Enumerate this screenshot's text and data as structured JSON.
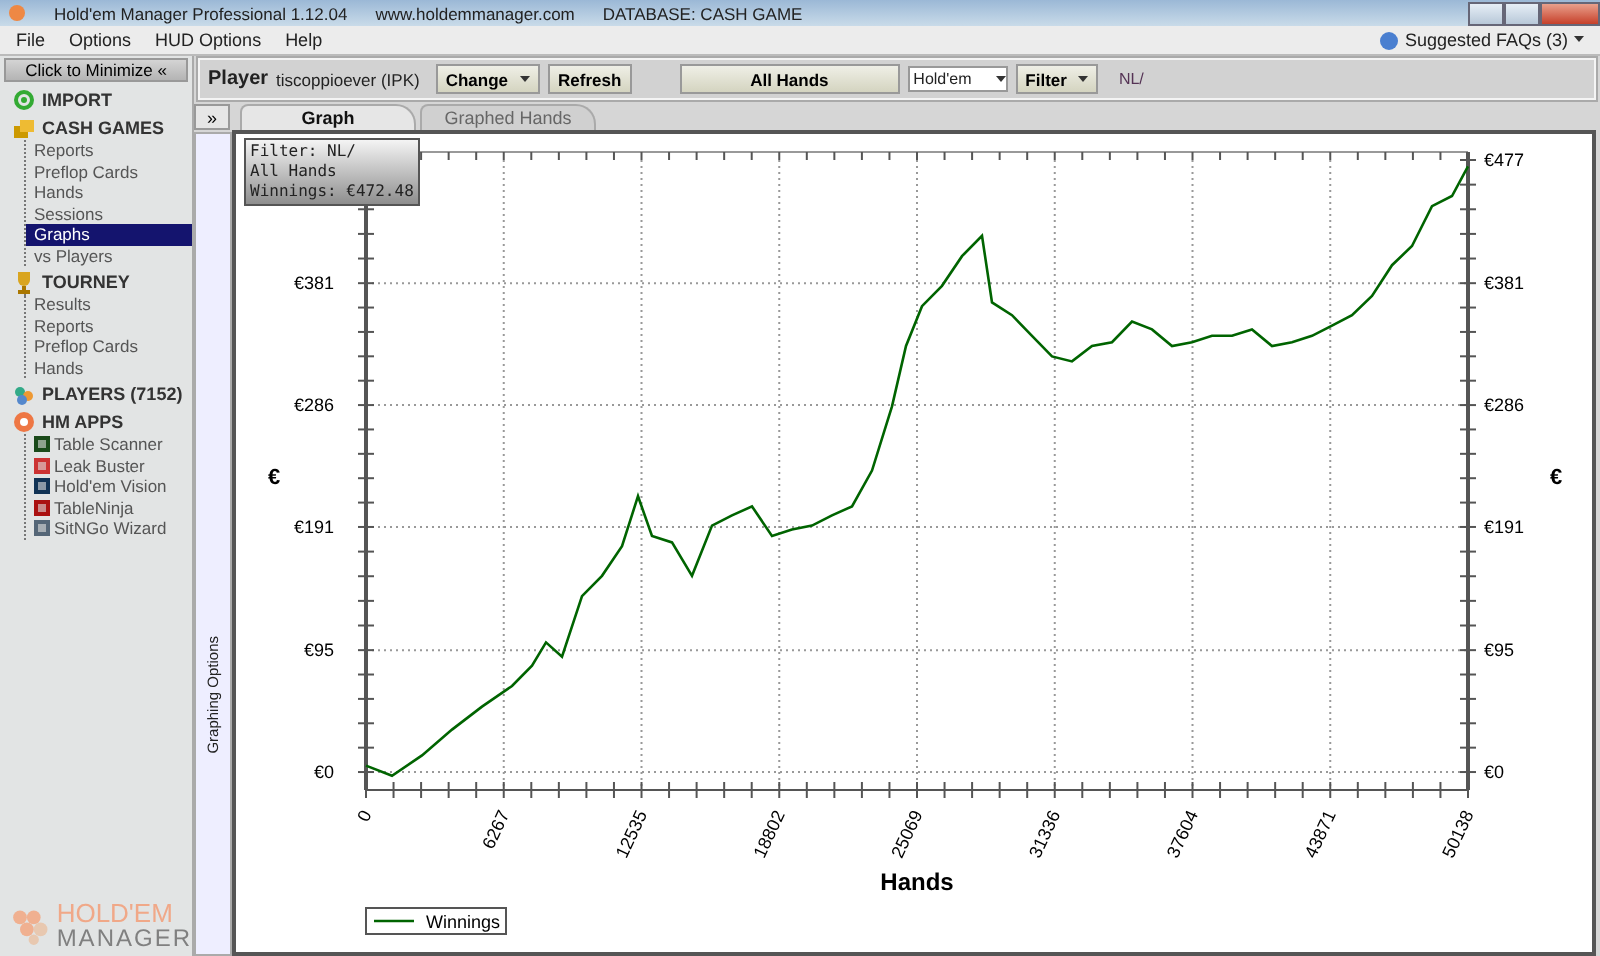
{
  "window": {
    "title": "Hold'em Manager Professional 1.12.04",
    "url": "www.holdemmanager.com",
    "database": "DATABASE: CASH GAME"
  },
  "menu": [
    "File",
    "Options",
    "HUD Options",
    "Help"
  ],
  "help": {
    "label": "Suggested FAQs (3)"
  },
  "sidebar": {
    "minimize": {
      "label": "Click to Minimize",
      "arrow": "«"
    },
    "sections": [
      {
        "label": "IMPORT"
      },
      {
        "label": "CASH GAMES",
        "children": [
          {
            "label": "Reports",
            "selected": false
          },
          {
            "label": "Preflop Cards",
            "selected": false
          },
          {
            "label": "Hands",
            "selected": false
          },
          {
            "label": "Sessions",
            "selected": false
          },
          {
            "label": "Graphs",
            "selected": true
          },
          {
            "label": "vs Players",
            "selected": false
          }
        ]
      },
      {
        "label": "TOURNEY",
        "children": [
          {
            "label": "Results",
            "selected": false
          },
          {
            "label": "Reports",
            "selected": false
          },
          {
            "label": "Preflop Cards",
            "selected": false
          },
          {
            "label": "Hands",
            "selected": false
          }
        ]
      },
      {
        "label": "PLAYERS (7152)"
      },
      {
        "label": "HM APPS",
        "children": [
          {
            "label": "Table Scanner",
            "selected": false
          },
          {
            "label": "Leak Buster",
            "selected": false
          },
          {
            "label": "Hold'em Vision",
            "selected": false
          },
          {
            "label": "TableNinja",
            "selected": false
          },
          {
            "label": "SitNGo Wizard",
            "selected": false
          }
        ]
      }
    ],
    "logo": [
      "HOLD'EM",
      "MANAGER"
    ]
  },
  "toolbar": {
    "player_label": "Player",
    "player": "tiscoppioever (IPK)",
    "change": "Change",
    "refresh": "Refresh",
    "all_hands": "All Hands",
    "game": "Hold'em",
    "filter": "Filter",
    "filter_value": "NL/"
  },
  "side_toggle": "»",
  "tabs": [
    {
      "label": "Graph",
      "selected": true
    },
    {
      "label": "Graphed Hands",
      "selected": false
    }
  ],
  "graphing_options": "Graphing Options",
  "graph": {
    "tooltip": [
      "Filter: NL/",
      "All Hands",
      "Winnings: €472.48"
    ],
    "right_axis_label": "€",
    "chart_data": {
      "type": "line",
      "grid": true,
      "xlabel": "Hands",
      "ylabel": "€",
      "xlim": [
        0,
        50138
      ],
      "ylim": [
        -14,
        477
      ],
      "xticks": [
        0,
        6267,
        12535,
        18802,
        25069,
        31336,
        37604,
        43871,
        50138
      ],
      "yticks": [
        {
          "value": 0,
          "label": "€0"
        },
        {
          "value": 95,
          "label": "€95"
        },
        {
          "value": 191,
          "label": "€191"
        },
        {
          "value": 286,
          "label": "€286"
        },
        {
          "value": 381,
          "label": "€381"
        },
        {
          "value": 477,
          "label": "€477"
        }
      ],
      "x": [
        0,
        1183,
        2548,
        3912,
        5277,
        6642,
        7552,
        8189,
        8917,
        9827,
        10737,
        11647,
        12375,
        13012,
        13921,
        14831,
        15741,
        16651,
        17561,
        18471,
        19381,
        20291,
        21201,
        22111,
        23021,
        23931,
        24568,
        25296,
        26206,
        27116,
        28026,
        28481,
        29391,
        30301,
        31211,
        32121,
        33031,
        33941,
        34851,
        35761,
        36671,
        37581,
        38491,
        39401,
        40311,
        41221,
        42131,
        43041,
        43951,
        44861,
        45771,
        46681,
        47591,
        48501,
        49411,
        50138
      ],
      "series": [
        {
          "name": "Winnings",
          "color": "#006400",
          "values": [
            5,
            -3,
            13,
            33,
            51,
            67,
            83,
            101,
            90,
            137,
            153,
            176,
            215,
            184,
            179,
            153,
            192,
            200,
            207,
            184,
            189,
            192,
            200,
            207,
            235,
            285,
            332,
            363,
            379,
            402,
            418,
            366,
            356,
            340,
            324,
            320,
            332,
            335,
            351,
            345,
            332,
            335,
            340,
            340,
            345,
            332,
            335,
            340,
            348,
            356,
            371,
            395,
            410,
            441,
            449,
            472
          ]
        }
      ]
    }
  }
}
